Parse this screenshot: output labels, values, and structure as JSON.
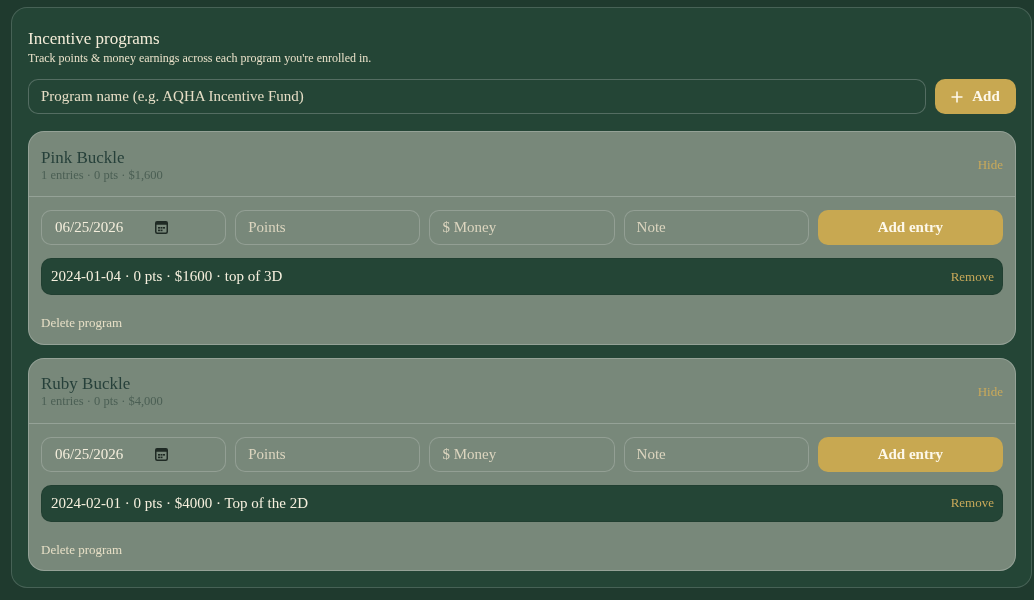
{
  "panel": {
    "title": "Incentive programs",
    "subtitle": "Track points & money earnings across each program you're enrolled in."
  },
  "new_program": {
    "placeholder": "Program name (e.g. AQHA Incentive Fund)",
    "button": "Add"
  },
  "programs": [
    {
      "name": "Pink Buckle",
      "summary": "1 entries · 0 pts · $1,600",
      "toggle": "Hide",
      "expanded": true,
      "date_field": {
        "value": "06/25/2026"
      },
      "points_field": {
        "placeholder": "Points"
      },
      "money_field": {
        "placeholder": "$ Money"
      },
      "note_field": {
        "placeholder": "Note"
      },
      "add_button": "Add entry",
      "entries": [
        {
          "text": "2024-01-04 · 0 pts · $1600 · top of 3D",
          "remove": "Remove"
        }
      ],
      "delete": "Delete program"
    },
    {
      "name": "Ruby Buckle",
      "summary": "1 entries · 0 pts · $4,000",
      "toggle": "Hide",
      "expanded": true,
      "date_field": {
        "value": "06/25/2026"
      },
      "points_field": {
        "placeholder": "Points"
      },
      "money_field": {
        "placeholder": "$ Money"
      },
      "note_field": {
        "placeholder": "Note"
      },
      "add_button": "Add entry",
      "entries": [
        {
          "text": "2024-02-01 · 0 pts · $4000 · Top of the 2D",
          "remove": "Remove"
        }
      ],
      "delete": "Delete program"
    }
  ]
}
